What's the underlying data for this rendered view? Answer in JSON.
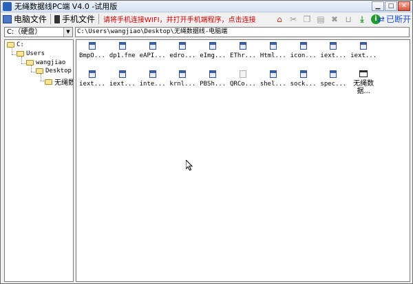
{
  "window": {
    "title": "无绳数据线PC端 V4.0 -试用版"
  },
  "toolbar": {
    "pc_files": "电脑文件",
    "phone_files": "手机文件",
    "notice": "请将手机连接WIFI，并打开手机端程序，点击连接",
    "disconnect": "已断开"
  },
  "drive": {
    "selected": "C:（硬盘）"
  },
  "path": {
    "value": "C:\\Users\\wangjiao\\Desktop\\无绳数据线-电脑端"
  },
  "tree": [
    "C:",
    "Users",
    "wangjiao",
    "Desktop",
    "无绳数"
  ],
  "files": [
    {
      "name": "BmpO...",
      "icon": "file-icon"
    },
    {
      "name": "dp1.fne",
      "icon": "file-icon"
    },
    {
      "name": "eAPI...",
      "icon": "file-icon"
    },
    {
      "name": "edro...",
      "icon": "file-icon"
    },
    {
      "name": "eImg...",
      "icon": "file-icon"
    },
    {
      "name": "EThr...",
      "icon": "file-icon"
    },
    {
      "name": "Html...",
      "icon": "file-icon"
    },
    {
      "name": "icon...",
      "icon": "file-icon"
    },
    {
      "name": "iext...",
      "icon": "file-icon"
    },
    {
      "name": "iext...",
      "icon": "file-icon"
    },
    {
      "name": "iext...",
      "icon": "file-icon"
    },
    {
      "name": "iext...",
      "icon": "file-icon"
    },
    {
      "name": "inte...",
      "icon": "file-icon"
    },
    {
      "name": "krnl...",
      "icon": "file-icon"
    },
    {
      "name": "PBSh...",
      "icon": "file-icon"
    },
    {
      "name": "QRCo...",
      "icon": "qr-file-icon"
    },
    {
      "name": "shel...",
      "icon": "file-icon"
    },
    {
      "name": "sock...",
      "icon": "file-icon"
    },
    {
      "name": "spec...",
      "icon": "file-icon"
    },
    {
      "name": "无绳数据...",
      "icon": "application-icon"
    }
  ]
}
